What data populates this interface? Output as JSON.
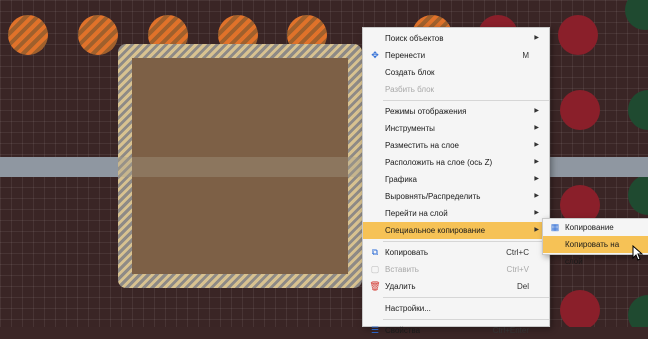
{
  "colors": {
    "highlight": "#f6c256",
    "menu_bg": "#f5f5f5",
    "canvas_bg": "#3a2525",
    "pad_orange": "#e0722a",
    "pad_red": "#8a1f2a",
    "track": "#8f97a1"
  },
  "context_menu": {
    "items": [
      {
        "label": "Поиск объектов",
        "submenu": true
      },
      {
        "label": "Перенести",
        "shortcut": "M",
        "icon": "move-icon"
      },
      {
        "label": "Создать блок"
      },
      {
        "label": "Разбить блок",
        "disabled": true
      },
      {
        "label": "Режимы отображения",
        "submenu": true
      },
      {
        "label": "Инструменты",
        "submenu": true
      },
      {
        "label": "Разместить на слое",
        "submenu": true
      },
      {
        "label": "Расположить на слое (ось Z)",
        "submenu": true
      },
      {
        "label": "Графика",
        "submenu": true
      },
      {
        "label": "Выровнять/Распределить",
        "submenu": true
      },
      {
        "label": "Перейти на слой",
        "submenu": true
      },
      {
        "label": "Специальное копирование",
        "submenu": true,
        "active": true
      },
      {
        "label": "Копировать",
        "shortcut": "Ctrl+C",
        "icon": "copy-icon"
      },
      {
        "label": "Вставить",
        "shortcut": "Ctrl+V",
        "icon": "paste-icon",
        "disabled": true
      },
      {
        "label": "Удалить",
        "shortcut": "Del",
        "icon": "trash-icon"
      },
      {
        "label": "Настройки..."
      },
      {
        "label": "Свойства",
        "shortcut": "Ctrl+Enter",
        "icon": "properties-icon"
      }
    ]
  },
  "submenu": {
    "items": [
      {
        "label": "Копирование матрицей",
        "icon": "matrix-icon"
      },
      {
        "label": "Копировать на слой",
        "active": true
      }
    ]
  }
}
